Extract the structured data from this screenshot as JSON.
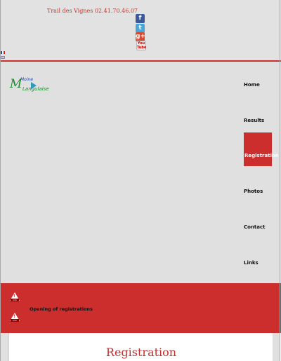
{
  "header": {
    "phone_text": "Trail des Vignes 02.41.70.46.07",
    "social": [
      {
        "name": "facebook-icon",
        "glyph": "f"
      },
      {
        "name": "twitter-icon",
        "glyph": "t"
      },
      {
        "name": "google-plus-icon",
        "glyph": "g+"
      },
      {
        "name": "youtube-icon",
        "glyph": "You Tube"
      }
    ],
    "languages": [
      "fr-flag-icon",
      "en-flag-icon"
    ]
  },
  "logo": {
    "letter": "M",
    "line1": "Moine",
    "line2": "Langulaise"
  },
  "nav": {
    "items": [
      "Home",
      "Results",
      "Registration",
      "Photos",
      "Contact",
      "Links"
    ],
    "active": "Registration"
  },
  "alerts": {
    "icon_tag": "Info",
    "message": "Opening of registrations"
  },
  "main": {
    "title": "Registration"
  },
  "colors": {
    "accent": "#cc2d2d",
    "background": "#e0e0e0",
    "text": "#111111"
  }
}
